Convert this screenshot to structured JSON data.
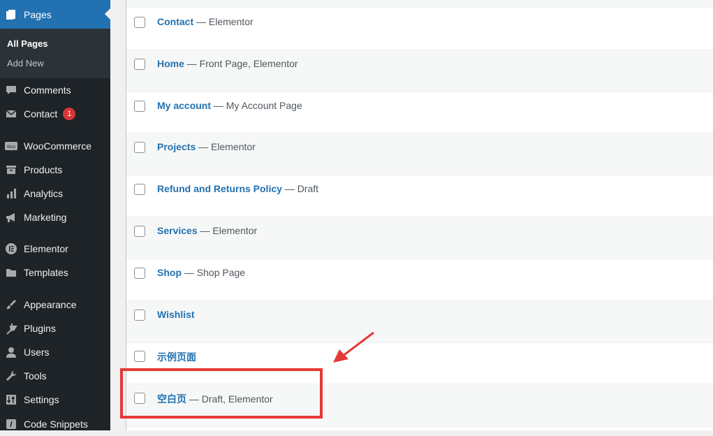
{
  "sidebar": {
    "pages_label": "Pages",
    "submenu": {
      "all_pages": "All Pages",
      "add_new": "Add New"
    },
    "items": [
      {
        "label": "Comments",
        "icon": "comment-icon"
      },
      {
        "label": "Contact",
        "icon": "envelope-icon",
        "badge": "1"
      },
      {
        "label": "WooCommerce",
        "icon": "woocommerce-icon"
      },
      {
        "label": "Products",
        "icon": "archive-icon"
      },
      {
        "label": "Analytics",
        "icon": "bar-chart-icon"
      },
      {
        "label": "Marketing",
        "icon": "megaphone-icon"
      },
      {
        "label": "Elementor",
        "icon": "elementor-icon"
      },
      {
        "label": "Templates",
        "icon": "folder-icon"
      },
      {
        "label": "Appearance",
        "icon": "paintbrush-icon"
      },
      {
        "label": "Plugins",
        "icon": "plug-icon"
      },
      {
        "label": "Users",
        "icon": "user-icon"
      },
      {
        "label": "Tools",
        "icon": "wrench-icon"
      },
      {
        "label": "Settings",
        "icon": "settings-sliders-icon"
      },
      {
        "label": "Code Snippets",
        "icon": "code-icon"
      }
    ]
  },
  "pages": [
    {
      "title": "Contact",
      "state": " — Elementor"
    },
    {
      "title": "Home",
      "state": " — Front Page, Elementor"
    },
    {
      "title": "My account",
      "state": " — My Account Page"
    },
    {
      "title": "Projects",
      "state": " — Elementor"
    },
    {
      "title": "Refund and Returns Policy",
      "state": " — Draft"
    },
    {
      "title": "Services",
      "state": " — Elementor"
    },
    {
      "title": "Shop",
      "state": " — Shop Page"
    },
    {
      "title": "Wishlist",
      "state": ""
    },
    {
      "title": "示例页面",
      "state": ""
    },
    {
      "title": "空白页",
      "state": " — Draft, Elementor"
    }
  ],
  "colors": {
    "sidebar_bg": "#1d2327",
    "accent": "#2271b1",
    "badge": "#d63638",
    "annotation": "#e53935"
  }
}
